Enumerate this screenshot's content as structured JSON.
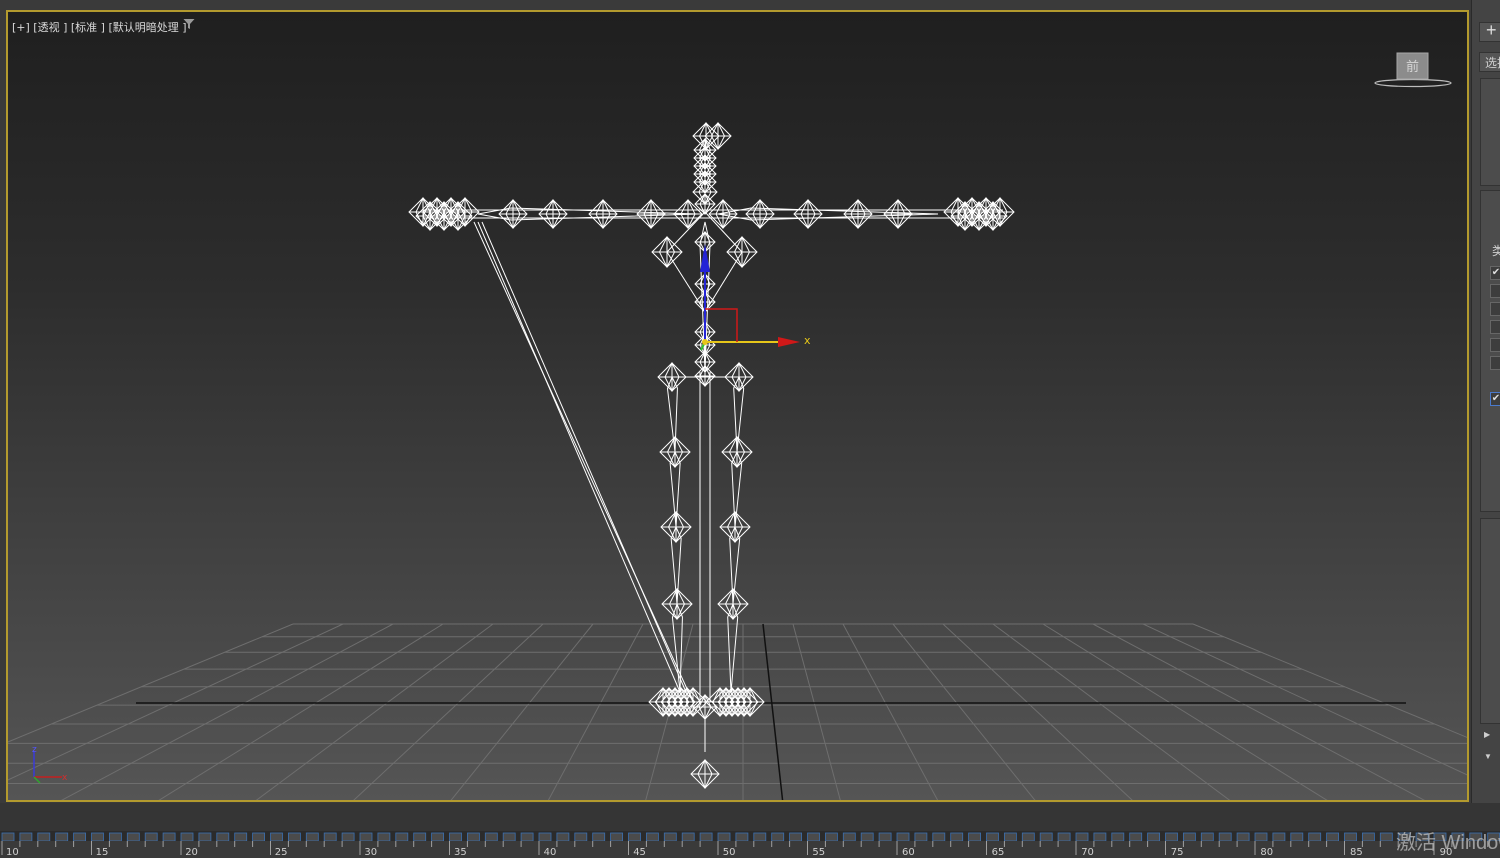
{
  "viewport": {
    "label": "[+] [透视 ] [标准 ] [默认明暗处理 ]",
    "viewcube_face": "前",
    "gizmo_x_label": "x",
    "mini_axis": {
      "z": "z",
      "x": "x"
    }
  },
  "right_panel": {
    "plus_glyph": "+",
    "select_text": "选择",
    "checkmark": "✔",
    "class_char": "类"
  },
  "timeline": {
    "ticks": [
      "10",
      "15",
      "20",
      "25",
      "30",
      "35",
      "40",
      "45",
      "50",
      "55",
      "60",
      "65",
      "70",
      "75",
      "80",
      "85",
      "90"
    ]
  },
  "watermark": "激活 Windows",
  "colors": {
    "viewport_border": "#b39a2e",
    "wireframe": "#ffffff",
    "gizmo_x": "#d01818",
    "gizmo_y": "#2fbf2f",
    "gizmo_z": "#2424d6",
    "gizmo_plane": "#e6c619"
  },
  "icons": [
    "filter-icon",
    "viewcube-icon",
    "axis-gizmo-icon",
    "plus-icon"
  ]
}
